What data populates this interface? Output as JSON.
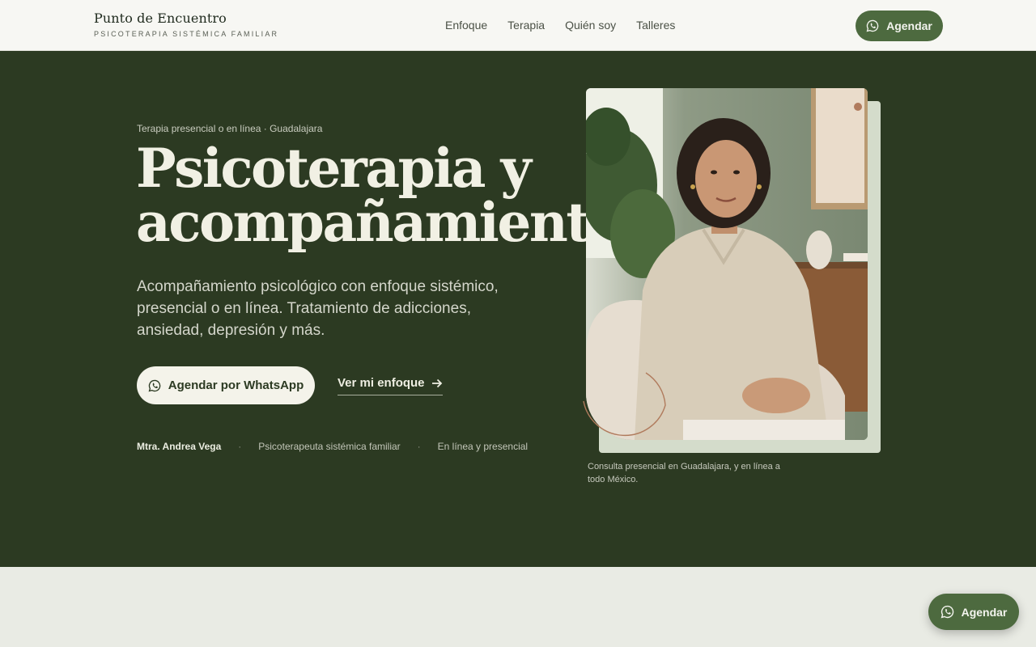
{
  "header": {
    "brand_name": "Punto de Encuentro",
    "brand_tagline": "PSICOTERAPIA SISTÉMICA FAMILIAR",
    "nav": [
      {
        "label": "Enfoque"
      },
      {
        "label": "Terapia"
      },
      {
        "label": "Quién soy"
      },
      {
        "label": "Talleres"
      }
    ],
    "cta_label": "Agendar"
  },
  "hero": {
    "eyebrow": "Terapia presencial o en línea · Guadalajara",
    "title_line1": "Psicoterapia y",
    "title_line2": "acompañamiento",
    "lede": "Acompañamiento psicológico con enfoque sistémico, presencial o en línea. Tratamiento de adicciones, ansiedad, depresión y más.",
    "primary_cta": "Agendar por WhatsApp",
    "secondary_cta": "Ver mi enfoque",
    "meta": {
      "name": "Mtra. Andrea Vega",
      "role": "Psicoterapeuta sistémica familiar",
      "mode": "En línea y presencial",
      "separator": "·"
    },
    "photo_caption": "Consulta presencial en Guadalajara, y en línea a todo México."
  },
  "floating_cta": "Agendar",
  "colors": {
    "brand_green": "#4d6a3f",
    "hero_bg": "#2c3a22",
    "cream": "#f4f3ea",
    "accent_copper": "#b07b5d"
  },
  "icons": {
    "whatsapp": "whatsapp-icon",
    "arrow": "arrow-right-icon"
  }
}
